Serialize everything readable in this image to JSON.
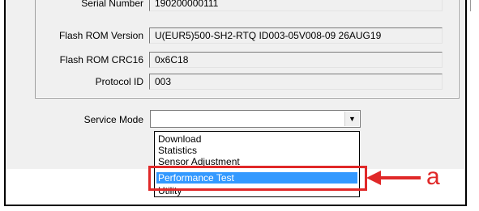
{
  "device_info": {
    "rows": [
      {
        "label": "Serial Number",
        "value": "190200000111"
      },
      {
        "label": "Flash ROM Version",
        "value": "U(EUR5)500-SH2-RTQ ID003-05V008-09 26AUG19"
      },
      {
        "label": "Flash ROM CRC16",
        "value": "0x6C18"
      },
      {
        "label": "Protocol ID",
        "value": "003"
      }
    ]
  },
  "service_mode": {
    "label": "Service Mode",
    "selected_value": "",
    "options": [
      "Download",
      "Statistics",
      "Sensor Adjustment",
      "Performance Test",
      "Utility"
    ],
    "highlighted_option": "Performance Test"
  },
  "annotation": {
    "callout_letter": "a",
    "color": "#e02828"
  },
  "colors": {
    "selection": "#3399ff",
    "dialog_bg": "#f0f0f0"
  }
}
